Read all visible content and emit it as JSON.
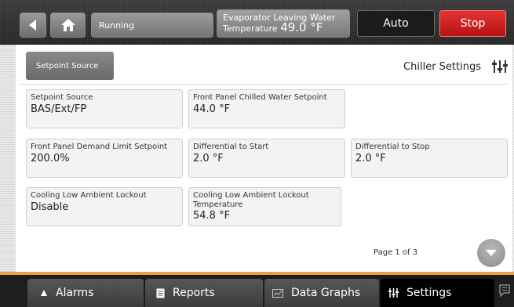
{
  "header": {
    "status": "Running",
    "temp_label": "Evaporator Leaving Water",
    "temp_prefix": "Temperature",
    "temp_value": "49.0 °F",
    "auto_label": "Auto",
    "stop_label": "Stop"
  },
  "panel": {
    "source_button": "Setpoint Source",
    "title": "Chiller Settings",
    "page_info": "Page 1 of 3"
  },
  "tiles": [
    {
      "label": "Setpoint Source",
      "value": "BAS/Ext/FP"
    },
    {
      "label": "Front Panel Chilled Water Setpoint",
      "value": "44.0 °F"
    },
    {
      "label": "Front Panel Demand Limit Setpoint",
      "value": "200.0%"
    },
    {
      "label": "Differential to Start",
      "value": "2.0 °F"
    },
    {
      "label": "Differential to Stop",
      "value": "2.0 °F"
    },
    {
      "label": "Cooling Low Ambient Lockout",
      "value": "Disable"
    },
    {
      "label": "Cooling Low Ambient Lockout Temperature",
      "value": "54.8 °F"
    }
  ],
  "nav": {
    "alarms": "Alarms",
    "reports": "Reports",
    "data_graphs": "Data Graphs",
    "settings": "Settings"
  },
  "colors": {
    "stop_red": "#d22222",
    "accent_orange": "#e8a04a"
  },
  "icons": [
    "back-arrow-icon",
    "home-icon",
    "sliders-icon",
    "chevron-down-icon",
    "bell-icon",
    "document-icon",
    "chart-icon",
    "chat-icon"
  ]
}
